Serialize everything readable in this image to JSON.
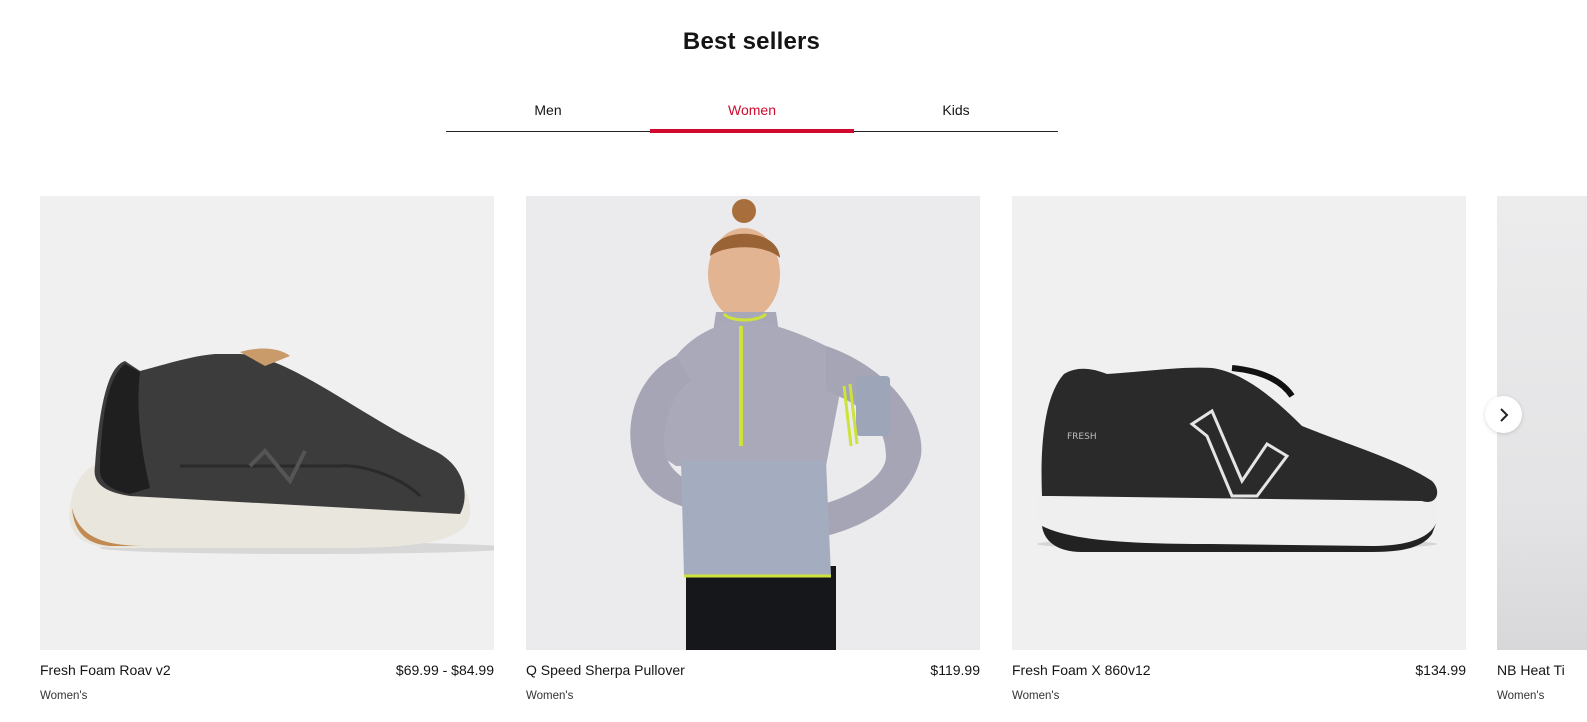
{
  "section": {
    "title": "Best sellers"
  },
  "tabs": [
    {
      "label": "Men",
      "active": false
    },
    {
      "label": "Women",
      "active": true
    },
    {
      "label": "Kids",
      "active": false
    }
  ],
  "products": [
    {
      "name": "Fresh Foam Roav v2",
      "price": "$69.99 - $84.99",
      "category": "Women's",
      "image": "shoe-image"
    },
    {
      "name": "Q Speed Sherpa Pullover",
      "price": "$119.99",
      "category": "Women's",
      "image": "pullover-image"
    },
    {
      "name": "Fresh Foam X 860v12",
      "price": "$134.99",
      "category": "Women's",
      "image": "shoe-image"
    },
    {
      "name": "NB Heat Ti",
      "price": "",
      "category": "Women's",
      "image": "product-image"
    }
  ],
  "carousel": {
    "next_icon": "chevron-right-icon"
  },
  "colors": {
    "accent": "#cf0a2c",
    "image_bg": "#f0f0f1",
    "text": "#151415"
  }
}
